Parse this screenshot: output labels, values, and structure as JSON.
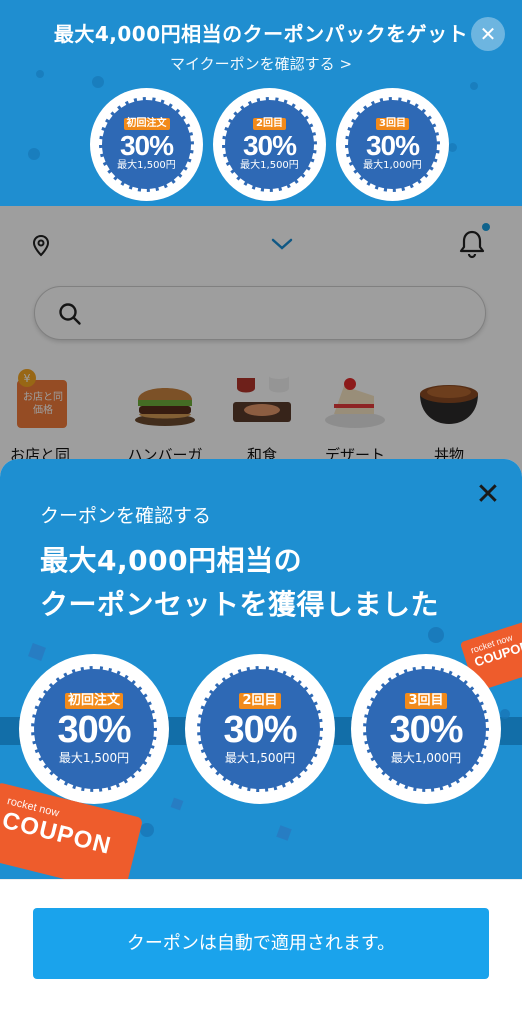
{
  "banner": {
    "title": "最大4,000円相当のクーポンパックをゲット",
    "link_label": "マイクーポンを確認する >",
    "close_icon": "close-icon",
    "coupons": [
      {
        "tag": "初回注文",
        "discount": "30%",
        "max": "最大1,500円"
      },
      {
        "tag": "2回目",
        "discount": "30%",
        "max": "最大1,500円"
      },
      {
        "tag": "3回目",
        "discount": "30%",
        "max": "最大1,000円"
      }
    ]
  },
  "header": {
    "location_icon": "location-pin-icon",
    "dropdown_icon": "chevron-down-icon",
    "notification_icon": "bell-icon"
  },
  "search": {
    "icon": "search-icon"
  },
  "categories": [
    {
      "label": "お店と同",
      "badge": "お店と同価格"
    },
    {
      "label": "ハンバーガ"
    },
    {
      "label": "和食"
    },
    {
      "label": "デザート"
    },
    {
      "label": "丼物"
    }
  ],
  "sheet": {
    "subtitle": "クーポンを確認する",
    "title_line1": "最大4,000円相当の",
    "title_line2": "クーポンセットを獲得しました",
    "close_icon": "close-icon",
    "coupons": [
      {
        "tag": "初回注文",
        "discount": "30%",
        "max": "最大1,500円"
      },
      {
        "tag": "2回目",
        "discount": "30%",
        "max": "最大1,500円"
      },
      {
        "tag": "3回目",
        "discount": "30%",
        "max": "最大1,000円"
      }
    ],
    "ticket_text": "COUPON",
    "ticket_brand": "rocket now",
    "cta_label": "クーポンは自動で適用されます。"
  },
  "colors": {
    "banner_blue": "#1f8ed0",
    "stamp_blue": "#2e69b5",
    "tag_orange": "#f28a1a",
    "ticket_orange": "#ee5c2c",
    "cta_blue": "#1aa3ec"
  }
}
